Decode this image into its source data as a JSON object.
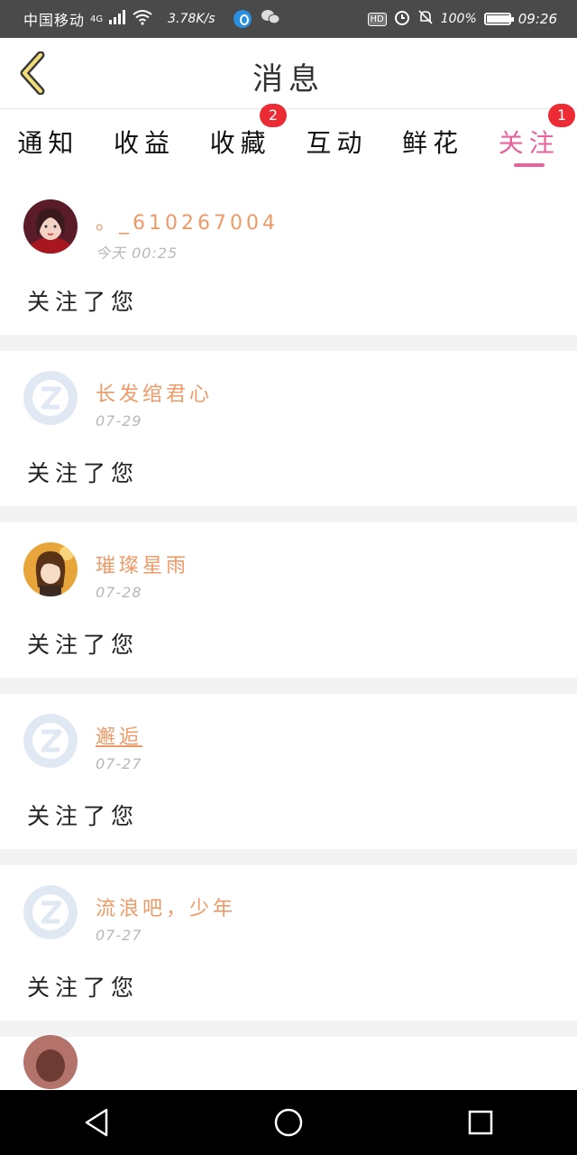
{
  "status_bar": {
    "carrier": "中国移动",
    "network": "4G",
    "speed": "3.78K/s",
    "hd": "HD",
    "battery": "100%",
    "battery_level": 1.0,
    "time": "09:26"
  },
  "header": {
    "title": "消息",
    "back_icon": "chevron-left-icon",
    "accent_color": "#e8629c"
  },
  "tabs": [
    {
      "label": "通知",
      "badge": ""
    },
    {
      "label": "收益",
      "badge": ""
    },
    {
      "label": "收藏",
      "badge": "2"
    },
    {
      "label": "互动",
      "badge": ""
    },
    {
      "label": "鲜花",
      "badge": ""
    },
    {
      "label": "关注",
      "badge": "1",
      "active": true
    }
  ],
  "messages": [
    {
      "username": "。_610267004",
      "date": "今天 00:25",
      "action": "关注了您",
      "avatar": "photo-avatar"
    },
    {
      "username": "长发绾君心",
      "date": "07-29",
      "action": "关注了您",
      "avatar": "default-avatar"
    },
    {
      "username": "璀璨星雨",
      "date": "07-28",
      "action": "关注了您",
      "avatar": "anime-avatar"
    },
    {
      "username": "邂逅",
      "date": "07-27",
      "action": "关注了您",
      "avatar": "default-avatar"
    },
    {
      "username": "流浪吧，少年",
      "date": "07-27",
      "action": "关注了您",
      "avatar": "default-avatar"
    }
  ],
  "nav_bar": {
    "back_icon": "triangle-back-icon",
    "home_icon": "circle-home-icon",
    "recents_icon": "square-recents-icon"
  }
}
